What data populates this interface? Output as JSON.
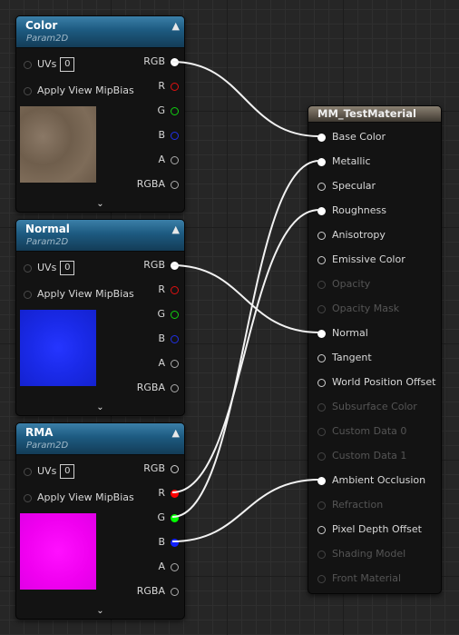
{
  "texture_nodes": [
    {
      "title": "Color",
      "subtitle": "Param2D",
      "uvs_label": "UVs",
      "uvs_value": "0",
      "mipbias_label": "Apply View MipBias",
      "outputs": [
        "RGB",
        "R",
        "G",
        "B",
        "A",
        "RGBA"
      ],
      "texture_color": "#7d6a57"
    },
    {
      "title": "Normal",
      "subtitle": "Param2D",
      "uvs_label": "UVs",
      "uvs_value": "0",
      "mipbias_label": "Apply View MipBias",
      "outputs": [
        "RGB",
        "R",
        "G",
        "B",
        "A",
        "RGBA"
      ],
      "texture_color": "#1e2cf0"
    },
    {
      "title": "RMA",
      "subtitle": "Param2D",
      "uvs_label": "UVs",
      "uvs_value": "0",
      "mipbias_label": "Apply View MipBias",
      "outputs": [
        "RGB",
        "R",
        "G",
        "B",
        "A",
        "RGBA"
      ],
      "texture_color": "#f000f0"
    }
  ],
  "material_node": {
    "title": "MM_TestMaterial",
    "inputs": [
      {
        "label": "Base Color",
        "state": "connected"
      },
      {
        "label": "Metallic",
        "state": "connected"
      },
      {
        "label": "Specular",
        "state": "enabled"
      },
      {
        "label": "Roughness",
        "state": "connected"
      },
      {
        "label": "Anisotropy",
        "state": "enabled"
      },
      {
        "label": "Emissive Color",
        "state": "enabled"
      },
      {
        "label": "Opacity",
        "state": "disabled"
      },
      {
        "label": "Opacity Mask",
        "state": "disabled"
      },
      {
        "label": "Normal",
        "state": "connected"
      },
      {
        "label": "Tangent",
        "state": "enabled"
      },
      {
        "label": "World Position Offset",
        "state": "enabled"
      },
      {
        "label": "Subsurface Color",
        "state": "disabled"
      },
      {
        "label": "Custom Data 0",
        "state": "disabled"
      },
      {
        "label": "Custom Data 1",
        "state": "disabled"
      },
      {
        "label": "Ambient Occlusion",
        "state": "connected"
      },
      {
        "label": "Refraction",
        "state": "disabled"
      },
      {
        "label": "Pixel Depth Offset",
        "state": "enabled"
      },
      {
        "label": "Shading Model",
        "state": "disabled"
      },
      {
        "label": "Front Material",
        "state": "disabled"
      }
    ]
  },
  "connections": [
    {
      "from": "Color.RGB",
      "to": "Base Color"
    },
    {
      "from": "Normal.RGB",
      "to": "Normal"
    },
    {
      "from": "RMA.R",
      "to": "Roughness"
    },
    {
      "from": "RMA.G",
      "to": "Metallic"
    },
    {
      "from": "RMA.B",
      "to": "Ambient Occlusion"
    }
  ],
  "icons": {
    "collapse": "chevron-up-icon",
    "expand": "chevron-down-icon"
  },
  "colors": {
    "background": "#262626",
    "texture_header": "#1d5a80",
    "material_header": "#5e564b",
    "wire": "#ffffff"
  }
}
